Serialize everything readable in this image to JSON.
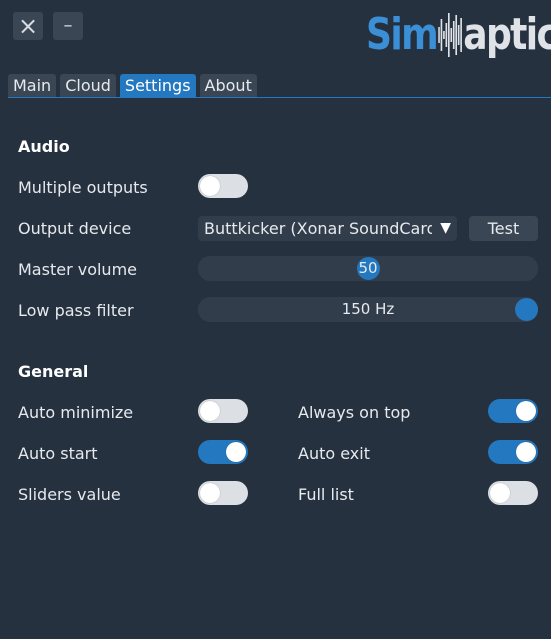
{
  "window": {
    "close_icon": "×",
    "minimize_icon": "–"
  },
  "logo": {
    "part1": "Sim",
    "part2": "aptic"
  },
  "tabs": [
    {
      "label": "Main",
      "active": false
    },
    {
      "label": "Cloud",
      "active": false
    },
    {
      "label": "Settings",
      "active": true
    },
    {
      "label": "About",
      "active": false
    }
  ],
  "audio": {
    "heading": "Audio",
    "multiple_outputs": {
      "label": "Multiple outputs",
      "on": false
    },
    "output_device": {
      "label": "Output device",
      "value": "Buttkicker (Xonar SoundCard) (Xonar",
      "arrow": "▼",
      "test_label": "Test"
    },
    "master_volume": {
      "label": "Master volume",
      "value": "50",
      "fraction": 0.5
    },
    "low_pass_filter": {
      "label": "Low pass filter",
      "value": "150 Hz",
      "fraction": 1.0
    }
  },
  "general": {
    "heading": "General",
    "auto_minimize": {
      "label": "Auto minimize",
      "on": false
    },
    "always_on_top": {
      "label": "Always on top",
      "on": true
    },
    "auto_start": {
      "label": "Auto start",
      "on": true
    },
    "auto_exit": {
      "label": "Auto exit",
      "on": true
    },
    "sliders_value": {
      "label": "Sliders value",
      "on": false
    },
    "full_list": {
      "label": "Full list",
      "on": false
    }
  },
  "colors": {
    "background": "#26313f",
    "accent": "#2478bf",
    "control": "#3b4654"
  }
}
